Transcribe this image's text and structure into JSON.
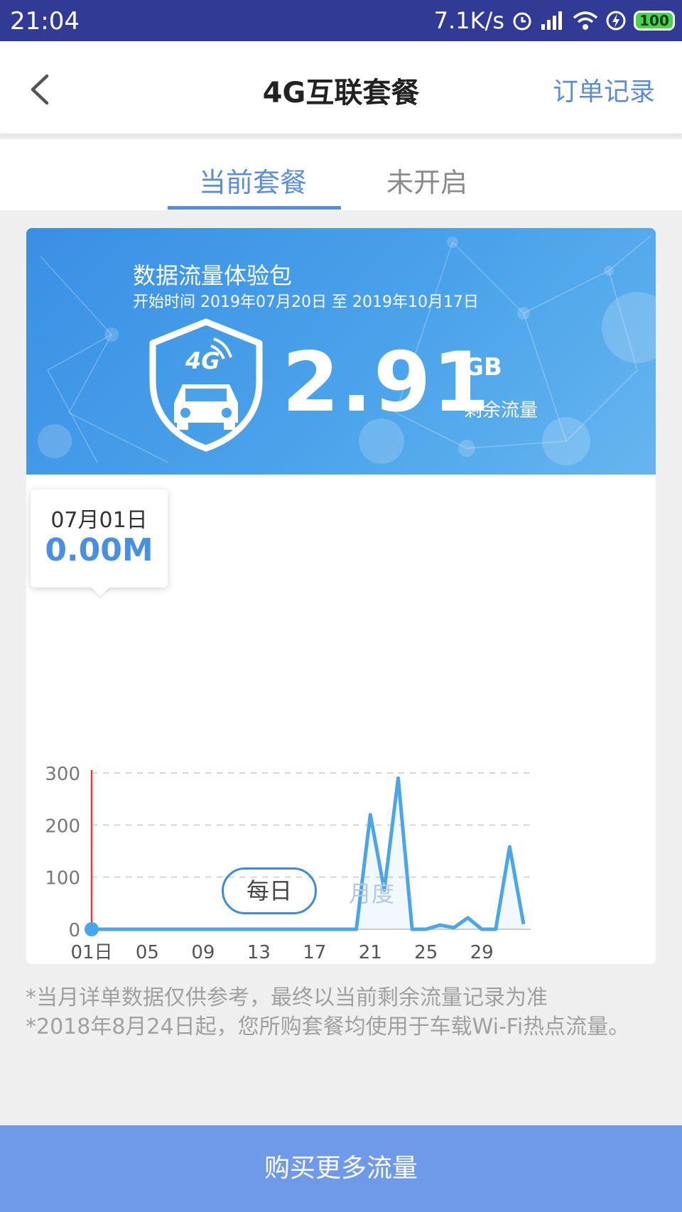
{
  "status_bar": {
    "time": "21:04",
    "speed": "7.1K/s",
    "battery": "100"
  },
  "header": {
    "title": "4G互联套餐",
    "order_link": "订单记录"
  },
  "tabs": [
    {
      "label": "当前套餐",
      "active": true
    },
    {
      "label": "未开启",
      "active": false
    }
  ],
  "package": {
    "name": "数据流量体验包",
    "period": "开始时间 2019年07月20日 至 2019年10月17日",
    "shield_text": "4G",
    "remaining_value": "2.91",
    "remaining_unit": "GB",
    "remaining_label": "剩余流量"
  },
  "tooltip": {
    "date": "07月01日",
    "value": "0.00M"
  },
  "period_toggle": {
    "daily": "每日",
    "monthly": "月度"
  },
  "notes": [
    "*当月详单数据仅供参考，最终以当前剩余流量记录为准",
    "*2018年8月24日起，您所购套餐均使用于车载Wi-Fi热点流量。"
  ],
  "buy_button": "购买更多流量",
  "colors": {
    "status_bar": "#313b95",
    "accent": "#5b8ed6",
    "line": "#4aa5ea",
    "buy_button": "#6e9ae9",
    "cursor": "#e53935"
  },
  "chart_data": {
    "type": "area",
    "x": [
      1,
      2,
      3,
      4,
      5,
      6,
      7,
      8,
      9,
      10,
      11,
      12,
      13,
      14,
      15,
      16,
      17,
      18,
      19,
      20,
      21,
      22,
      23,
      24,
      25,
      26,
      27,
      28,
      29,
      30,
      31
    ],
    "x_tick_labels": [
      "01日",
      "05",
      "09",
      "13",
      "17",
      "21",
      "25",
      "29"
    ],
    "x_tick_values": [
      1,
      5,
      9,
      13,
      17,
      21,
      25,
      29
    ],
    "x_sublabel": "07月",
    "series": [
      {
        "values": [
          0,
          0,
          0,
          0,
          0,
          0,
          0,
          0,
          0,
          0,
          0,
          0,
          0,
          0,
          0,
          0,
          0,
          0,
          0,
          0,
          220,
          75,
          290,
          0,
          0,
          8,
          3,
          22,
          0,
          0,
          158,
          10
        ]
      }
    ],
    "y_ticks": [
      0,
      100,
      200,
      300
    ],
    "ylim": [
      0,
      300
    ],
    "grid": true,
    "selected_x": 1
  }
}
